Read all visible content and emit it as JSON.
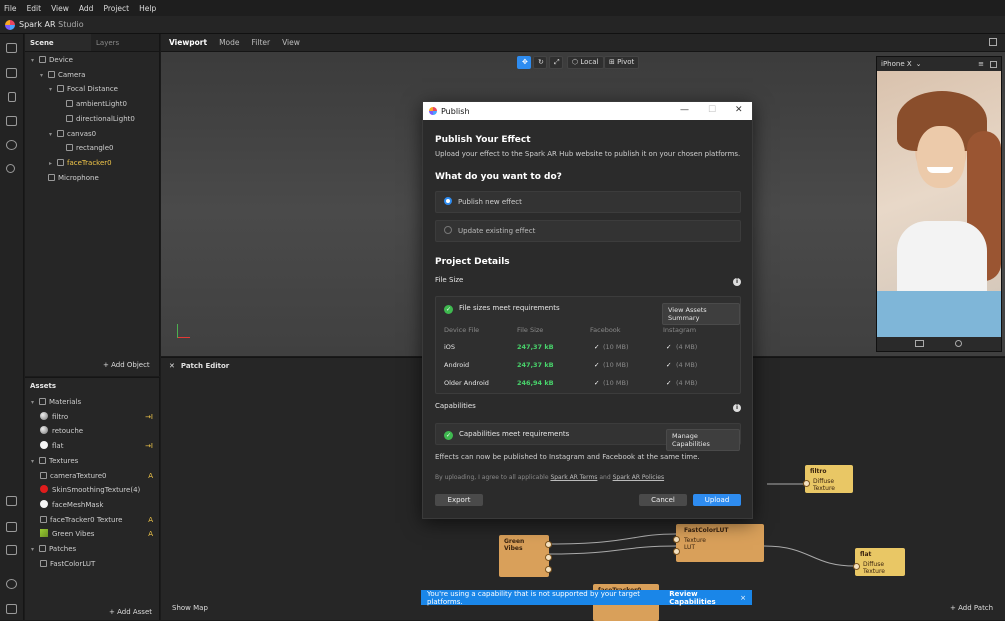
{
  "menu": [
    "File",
    "Edit",
    "View",
    "Add",
    "Project",
    "Help"
  ],
  "app": {
    "name": "Spark AR",
    "studio": "Studio"
  },
  "scene": {
    "tabs": [
      "Scene",
      "Layers"
    ],
    "tree": [
      {
        "label": "Device",
        "indent": 0,
        "caret": "▾",
        "hl": false
      },
      {
        "label": "Camera",
        "indent": 1,
        "caret": "▾",
        "hl": false
      },
      {
        "label": "Focal Distance",
        "indent": 2,
        "caret": "▾",
        "hl": false
      },
      {
        "label": "ambientLight0",
        "indent": 3,
        "caret": "",
        "hl": false
      },
      {
        "label": "directionalLight0",
        "indent": 3,
        "caret": "",
        "hl": false
      },
      {
        "label": "canvas0",
        "indent": 2,
        "caret": "▾",
        "hl": false
      },
      {
        "label": "rectangle0",
        "indent": 3,
        "caret": "",
        "hl": false
      },
      {
        "label": "faceTracker0",
        "indent": 2,
        "caret": "▸",
        "hl": true
      },
      {
        "label": "Microphone",
        "indent": 1,
        "caret": "",
        "hl": false
      }
    ],
    "add_object": "Add Object"
  },
  "assets": {
    "title": "Assets",
    "items": [
      {
        "label": "Materials",
        "indent": 0,
        "kind": "folder",
        "badge": ""
      },
      {
        "label": "filtro",
        "indent": 1,
        "kind": "sphere-gray",
        "badge": "→I"
      },
      {
        "label": "retouche",
        "indent": 1,
        "kind": "sphere-gray",
        "badge": ""
      },
      {
        "label": "flat",
        "indent": 1,
        "kind": "sphere-white",
        "badge": "→I"
      },
      {
        "label": "Textures",
        "indent": 0,
        "kind": "folder",
        "badge": ""
      },
      {
        "label": "cameraTexture0",
        "indent": 1,
        "kind": "tex",
        "badge": "A"
      },
      {
        "label": "SkinSmoothingTexture(4)",
        "indent": 1,
        "kind": "red",
        "badge": ""
      },
      {
        "label": "faceMeshMask",
        "indent": 1,
        "kind": "sphere-white",
        "badge": ""
      },
      {
        "label": "faceTracker0 Texture",
        "indent": 1,
        "kind": "tex",
        "badge": "A"
      },
      {
        "label": "Green Vibes",
        "indent": 1,
        "kind": "img",
        "badge": "A"
      },
      {
        "label": "Patches",
        "indent": 0,
        "kind": "folder",
        "badge": ""
      },
      {
        "label": "FastColorLUT",
        "indent": 1,
        "kind": "patch",
        "badge": ""
      }
    ],
    "add_asset": "Add Asset"
  },
  "viewport": {
    "tabs": [
      "Viewport",
      "Mode",
      "Filter",
      "View"
    ],
    "local": "Local",
    "pivot": "Pivot",
    "device": "iPhone X"
  },
  "patch_editor": {
    "title": "Patch Editor",
    "show_map": "Show Map",
    "add_patch": "Add Patch",
    "nodes": {
      "filtro": "filtro",
      "filtro_port": "Diffuse Texture",
      "lut": "FastColorLUT",
      "lut_in1": "Texture",
      "lut_in2": "LUT",
      "green": "Green Vibes",
      "flat": "flat",
      "flat_port": "Diffuse Texture",
      "face": "faceTracker0 Text"
    }
  },
  "publish": {
    "window_title": "Publish",
    "heading": "Publish Your Effect",
    "subtitle": "Upload your effect to the Spark AR Hub website to publish it on your chosen platforms.",
    "question": "What do you want to do?",
    "option_new": "Publish new effect",
    "option_update": "Update existing effect",
    "project_details": "Project Details",
    "file_size": "File Size",
    "file_ok": "File sizes meet requirements",
    "view_assets": "View Assets Summary",
    "columns": [
      "Device File",
      "File Size",
      "Facebook",
      "Instagram"
    ],
    "rows": [
      {
        "device": "iOS",
        "size": "247,37 kB",
        "fb": "(10 MB)",
        "ig": "(4 MB)"
      },
      {
        "device": "Android",
        "size": "247,37 kB",
        "fb": "(10 MB)",
        "ig": "(4 MB)"
      },
      {
        "device": "Older Android",
        "size": "246,94 kB",
        "fb": "(10 MB)",
        "ig": "(4 MB)"
      }
    ],
    "capabilities": "Capabilities",
    "cap_ok": "Capabilities meet requirements",
    "manage_caps": "Manage Capabilities",
    "cap_note": "Effects can now be published to Instagram and Facebook at the same time.",
    "terms_prefix": "By uploading, I agree to all applicable",
    "terms_link1": "Spark AR Terms",
    "terms_and": "and",
    "terms_link2": "Spark AR Policies",
    "export": "Export",
    "cancel": "Cancel",
    "upload": "Upload"
  },
  "toast": {
    "message": "You're using a capability that is not supported by your target platforms.",
    "action": "Review Capabilities",
    "close": "×"
  },
  "colors": {
    "accent": "#2e8cf0",
    "success": "#3fb950",
    "highlight": "#f2c74a",
    "node": "#d9a05a"
  }
}
